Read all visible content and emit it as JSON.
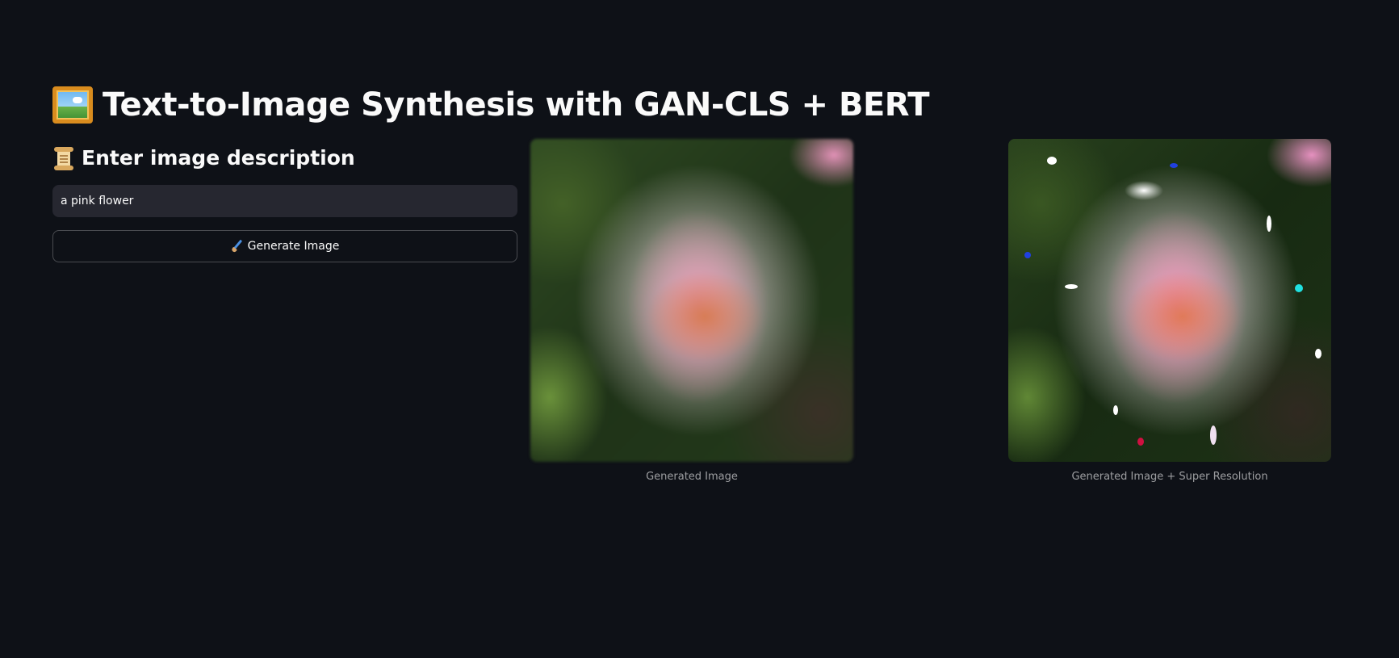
{
  "header": {
    "title": "Text-to-Image Synthesis with GAN-CLS + BERT",
    "title_icon": "framed-picture-icon"
  },
  "form": {
    "subheader": "Enter image description",
    "subheader_icon": "scroll-icon",
    "description_value": "a pink flower",
    "generate_button_label": "Generate Image",
    "generate_button_icon": "paintbrush-icon"
  },
  "results": {
    "image1_caption": "Generated Image",
    "image2_caption": "Generated Image + Super Resolution"
  },
  "colors": {
    "background": "#0e1117",
    "input_background": "#262730",
    "text": "#fafafa"
  }
}
